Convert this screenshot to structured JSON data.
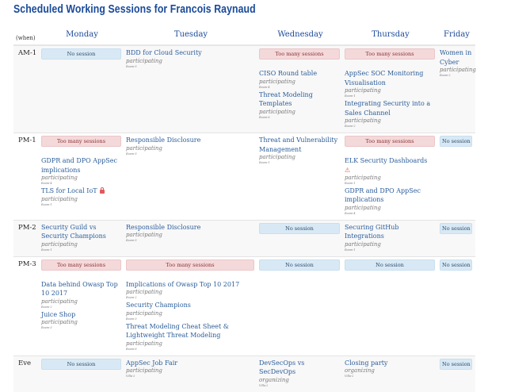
{
  "title": "Scheduled Working Sessions for Francois Raynaud",
  "when_label": "(when)",
  "days": [
    "Monday",
    "Tuesday",
    "Wednesday",
    "Thursday",
    "Friday"
  ],
  "labels": {
    "no_session": "No session",
    "too_many": "Too many sessions"
  },
  "colors": {
    "link": "#2a5d9a",
    "title": "#1a4a9a",
    "no_session_bg": "#d8e9f5",
    "too_many_bg": "#f4d9da"
  },
  "rows": [
    {
      "slot": "AM-1",
      "cells": [
        {
          "status": "none",
          "sessions": []
        },
        {
          "status": "",
          "sessions": [
            {
              "title": "BDD for Cloud Security",
              "role": "participating",
              "room": "Room-5"
            }
          ]
        },
        {
          "status": "many",
          "sessions": [
            {
              "title": "CISO Round table",
              "role": "participating",
              "room": "Room-4"
            },
            {
              "title": "Threat Modeling Templates",
              "role": "participating",
              "room": "Room-6"
            }
          ]
        },
        {
          "status": "many",
          "sessions": [
            {
              "title": "AppSec SOC Monitoring Visualisation",
              "role": "participating",
              "room": "Room-1"
            },
            {
              "title": "Integrating Security into a Sales Channel",
              "role": "participating",
              "room": "Room-2"
            }
          ]
        },
        {
          "status": "",
          "sessions": [
            {
              "title": "Women in Cyber",
              "role": "participating",
              "room": "Room-2"
            }
          ]
        }
      ]
    },
    {
      "slot": "PM-1",
      "cells": [
        {
          "status": "many",
          "sessions": [
            {
              "title": "GDPR and DPO AppSec implications",
              "role": "participating",
              "room": "Room-4"
            },
            {
              "title": "TLS for Local IoT",
              "role": "participating",
              "room": "Room-1",
              "icon": "lock-icon"
            }
          ]
        },
        {
          "status": "",
          "sessions": [
            {
              "title": "Responsible Disclosure",
              "role": "participating",
              "room": "Room-5"
            }
          ]
        },
        {
          "status": "",
          "sessions": [
            {
              "title": "Threat and Vulnerability Management",
              "role": "participating",
              "room": "Room-1"
            }
          ]
        },
        {
          "status": "many",
          "sessions": [
            {
              "title": "ELK Security Dashboards",
              "role": "participating",
              "room": "Room-1",
              "icon": "warning-icon"
            },
            {
              "title": "GDPR and DPO AppSec implications",
              "role": "participating",
              "room": "Room-4"
            }
          ]
        },
        {
          "status": "none",
          "sessions": []
        }
      ]
    },
    {
      "slot": "PM-2",
      "cells": [
        {
          "status": "",
          "sessions": [
            {
              "title": "Security Guild vs Security Champions",
              "role": "participating",
              "room": "Room-1"
            }
          ]
        },
        {
          "status": "",
          "sessions": [
            {
              "title": "Responsible Disclosure",
              "role": "participating",
              "room": "Room-5"
            }
          ]
        },
        {
          "status": "none",
          "sessions": []
        },
        {
          "status": "",
          "sessions": [
            {
              "title": "Securing GitHub Integrations",
              "role": "participating",
              "room": "Room-1"
            }
          ]
        },
        {
          "status": "none",
          "sessions": []
        }
      ]
    },
    {
      "slot": "PM-3",
      "cells": [
        {
          "status": "many",
          "sessions": [
            {
              "title": "Data behind Owasp Top 10 2017",
              "role": "participating",
              "room": "Room-2"
            },
            {
              "title": "Juice Shop",
              "role": "participating",
              "room": "Room-3"
            }
          ]
        },
        {
          "status": "many",
          "sessions": [
            {
              "title": "Implications of Owasp Top 10 2017",
              "role": "participating",
              "room": "Room-2"
            },
            {
              "title": "Security Champions",
              "role": "participating",
              "room": "Room-3"
            },
            {
              "title": "Threat Modeling Cheat Sheet & Lightweight Threat Modeling",
              "role": "participating",
              "room": "Room-6"
            }
          ]
        },
        {
          "status": "none",
          "sessions": []
        },
        {
          "status": "none",
          "sessions": []
        },
        {
          "status": "none",
          "sessions": []
        }
      ]
    },
    {
      "slot": "Eve",
      "cells": [
        {
          "status": "none",
          "sessions": []
        },
        {
          "status": "",
          "sessions": [
            {
              "title": "AppSec Job Fair",
              "role": "participating",
              "room": "Villa-2"
            }
          ]
        },
        {
          "status": "",
          "sessions": [
            {
              "title": "DevSecOps vs SecDevOps",
              "role": "organizing",
              "room": "Villa-2"
            }
          ]
        },
        {
          "status": "",
          "sessions": [
            {
              "title": "Closing party",
              "role": "organizing",
              "room": "Villa-2"
            }
          ]
        },
        {
          "status": "none",
          "sessions": []
        }
      ]
    }
  ]
}
